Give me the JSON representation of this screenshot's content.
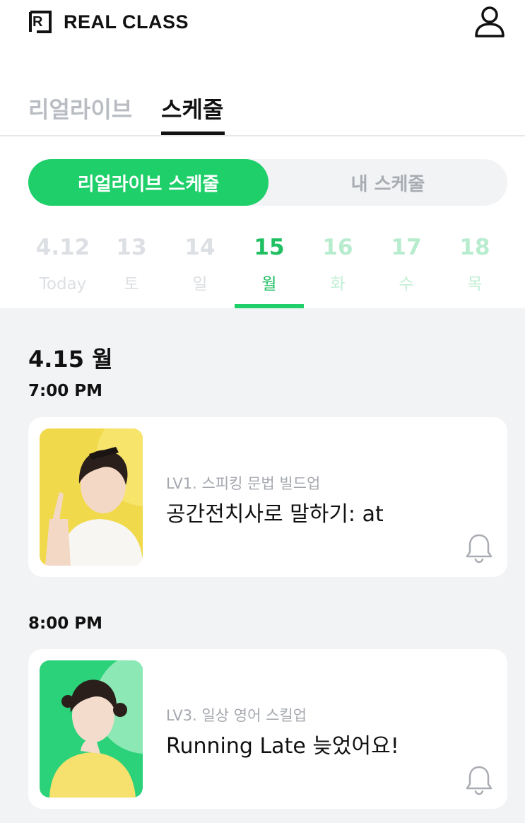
{
  "app": {
    "logo_letter": "R",
    "logo_text": "REAL CLASS",
    "profile_icon": "person-icon"
  },
  "tabs": [
    {
      "label": "리얼라이브",
      "active": false
    },
    {
      "label": "스케줄",
      "active": true
    }
  ],
  "segment": {
    "active_label": "리얼라이브 스케줄",
    "inactive_label": "내 스케줄"
  },
  "days": [
    {
      "num": "4.12",
      "label": "Today",
      "state": "past"
    },
    {
      "num": "13",
      "label": "토",
      "state": "past"
    },
    {
      "num": "14",
      "label": "일",
      "state": "past"
    },
    {
      "num": "15",
      "label": "월",
      "state": "selected"
    },
    {
      "num": "16",
      "label": "화",
      "state": "future"
    },
    {
      "num": "17",
      "label": "수",
      "state": "future"
    },
    {
      "num": "18",
      "label": "목",
      "state": "future"
    }
  ],
  "schedule": {
    "date_heading": "4.15 월",
    "slots": [
      {
        "time": "7:00 PM",
        "level": "LV1. 스피킹 문법 빌드업",
        "title": "공간전치사로 말하기: at",
        "thumb_bg": "#f0d94a",
        "thumb_accent": "#f7e46a",
        "icon": "bell-icon"
      },
      {
        "time": "8:00 PM",
        "level": "LV3. 일상 영어 스킬업",
        "title": "Running Late 늦었어요!",
        "thumb_bg": "#2bd27a",
        "thumb_accent": "#8ce8b4",
        "icon": "bell-icon"
      }
    ]
  },
  "colors": {
    "accent": "#1fcf6a",
    "background": "#f2f3f5"
  }
}
